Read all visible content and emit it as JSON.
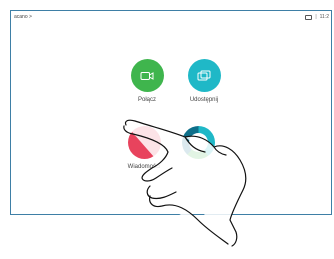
{
  "status": {
    "name": "acano",
    "chevron": ">",
    "separator": "|",
    "time": "11:2"
  },
  "tiles": {
    "call": {
      "label": "Połącz",
      "icon": "video-camera-icon",
      "color": "#3fb54d"
    },
    "share": {
      "label": "Udostępnij",
      "icon": "share-screen-icon",
      "color": "#1fb8c7"
    },
    "messages": {
      "label": "Wiadomości",
      "icon": "message-icon",
      "color": "#e8435d"
    },
    "other": {
      "label": "",
      "icon": "ring-icon"
    }
  },
  "overlay": {
    "icon": "hand-pointer-icon"
  }
}
